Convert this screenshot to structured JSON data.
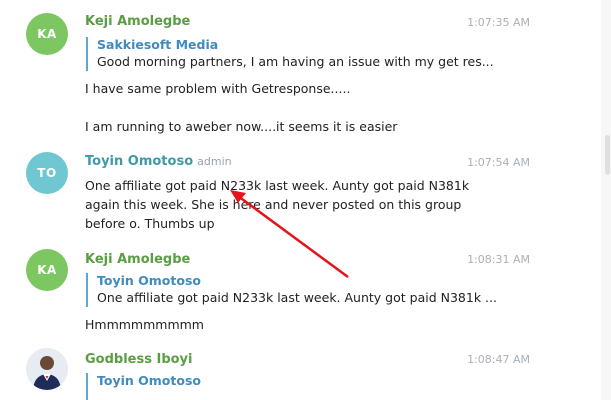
{
  "messages": [
    {
      "initials": "KA",
      "author": "Keji Amolegbe",
      "time": "1:07:35 AM",
      "reply_author": "Sakkiesoft Media",
      "reply_text": "Good morning partners, I am having an issue with my get res...",
      "lines": [
        "I have same problem with Getresponse.....",
        "",
        "I am running to aweber now....it seems it is easier"
      ],
      "avatar_color": "#7dc763"
    },
    {
      "initials": "TO",
      "author": "Toyin Omotoso",
      "badge": "admin",
      "time": "1:07:54 AM",
      "lines": [
        "One affiliate got paid N233k last week. Aunty got paid N381k",
        "again this week. She is here and never posted on this group",
        "before o. Thumbs up"
      ],
      "avatar_color": "#6ec7d1"
    },
    {
      "initials": "KA",
      "author": "Keji Amolegbe",
      "time": "1:08:31 AM",
      "reply_author": "Toyin Omotoso",
      "reply_text": "One affiliate got paid N233k last week. Aunty got paid N381k ...",
      "lines": [
        "Hmmmmmmmmm"
      ],
      "avatar_color": "#7dc763"
    },
    {
      "author": "Godbless Iboyi",
      "time": "1:08:47 AM",
      "reply_author": "Toyin Omotoso"
    }
  ],
  "colors": {
    "arrow": "#e3141b",
    "reply_bar": "#5fa8d6"
  }
}
